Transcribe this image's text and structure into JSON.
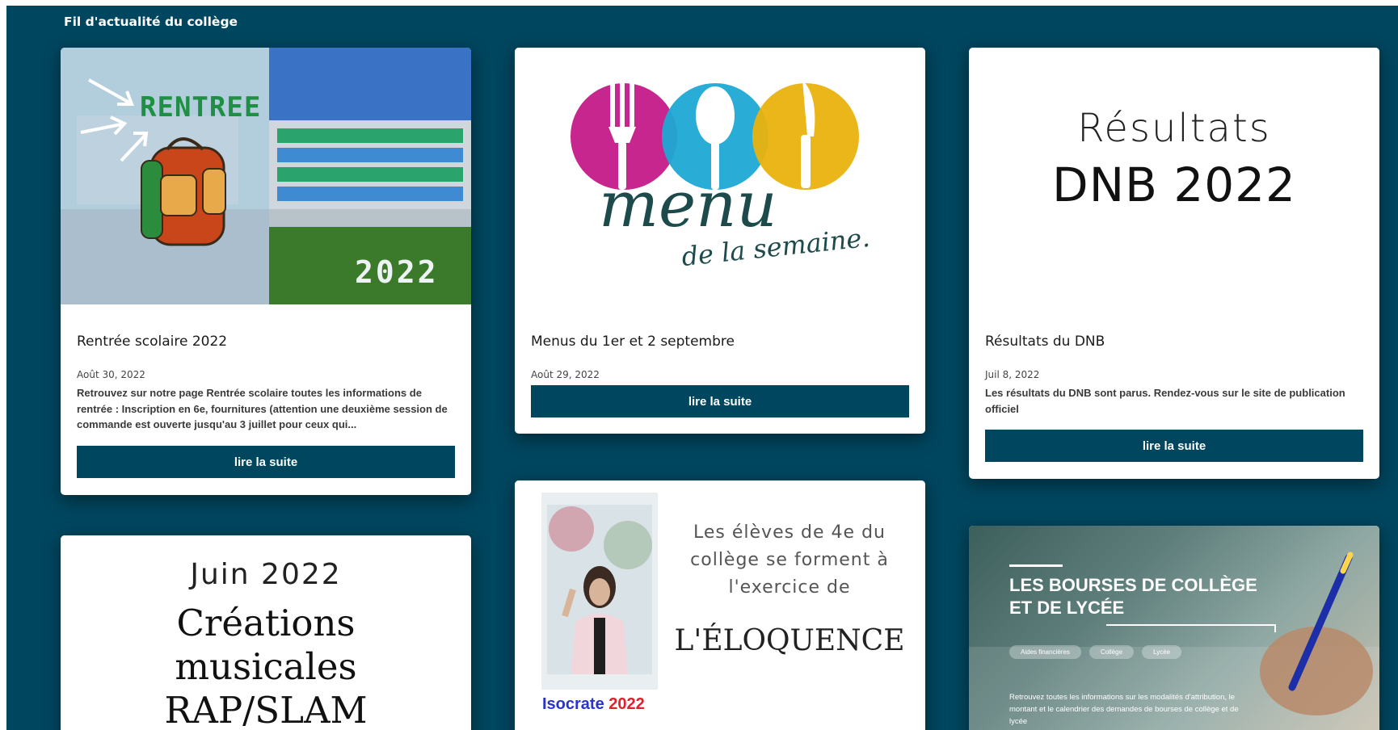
{
  "feed": {
    "title": "Fil d'actualité du collège"
  },
  "cards": [
    {
      "image": {
        "text": "RENTREE",
        "year": "2022"
      },
      "title": "Rentrée scolaire 2022",
      "date": "Août 30, 2022",
      "excerpt": "Retrouvez sur notre page Rentrée scolaire toutes les informations de rentrée : Inscription en 6e, fournitures (attention une deuxième session de commande est ouverte jusqu'au 3 juillet pour ceux qui...",
      "button": "lire la suite"
    },
    {
      "image": {
        "line1": "menu",
        "line2": "de la semaine."
      },
      "title": "Menus du 1er et 2 septembre",
      "date": "Août 29, 2022",
      "button": "lire la suite"
    },
    {
      "image": {
        "line1": "Résultats",
        "line2": "DNB 2022"
      },
      "title": "Résultats du DNB",
      "date": "Juil 8, 2022",
      "excerpt": "Les résultats du DNB sont parus. Rendez-vous sur le site de publication officiel",
      "button": "lire la suite"
    },
    {
      "image": {
        "line1": "Juin 2022",
        "line2": "Créations",
        "line3": "musicales",
        "line4": "RAP/SLAM"
      }
    },
    {
      "image": {
        "text": "Les élèves de 4e du collège se forment à l'exercice de",
        "big": "L'ÉLOQUENCE",
        "brand_a": "Isocrate",
        "brand_b": "2022"
      }
    },
    {
      "image": {
        "title_line1": "LES BOURSES DE COLLÈGE",
        "title_line2": "ET DE LYCÉE",
        "tags": [
          "Aides financières",
          "Collège",
          "Lycée"
        ],
        "desc": "Retrouvez toutes les informations sur les modalités d'attribution, le montant et le calendrier des demandes de bourses de collège et de lycée"
      }
    }
  ],
  "colors": {
    "background": "#00465f",
    "button": "#00465f",
    "menu_magenta": "#c8268f",
    "menu_cyan": "#1ea8d4",
    "menu_yellow": "#e9b20d",
    "rentree_green": "#1f8f44"
  }
}
